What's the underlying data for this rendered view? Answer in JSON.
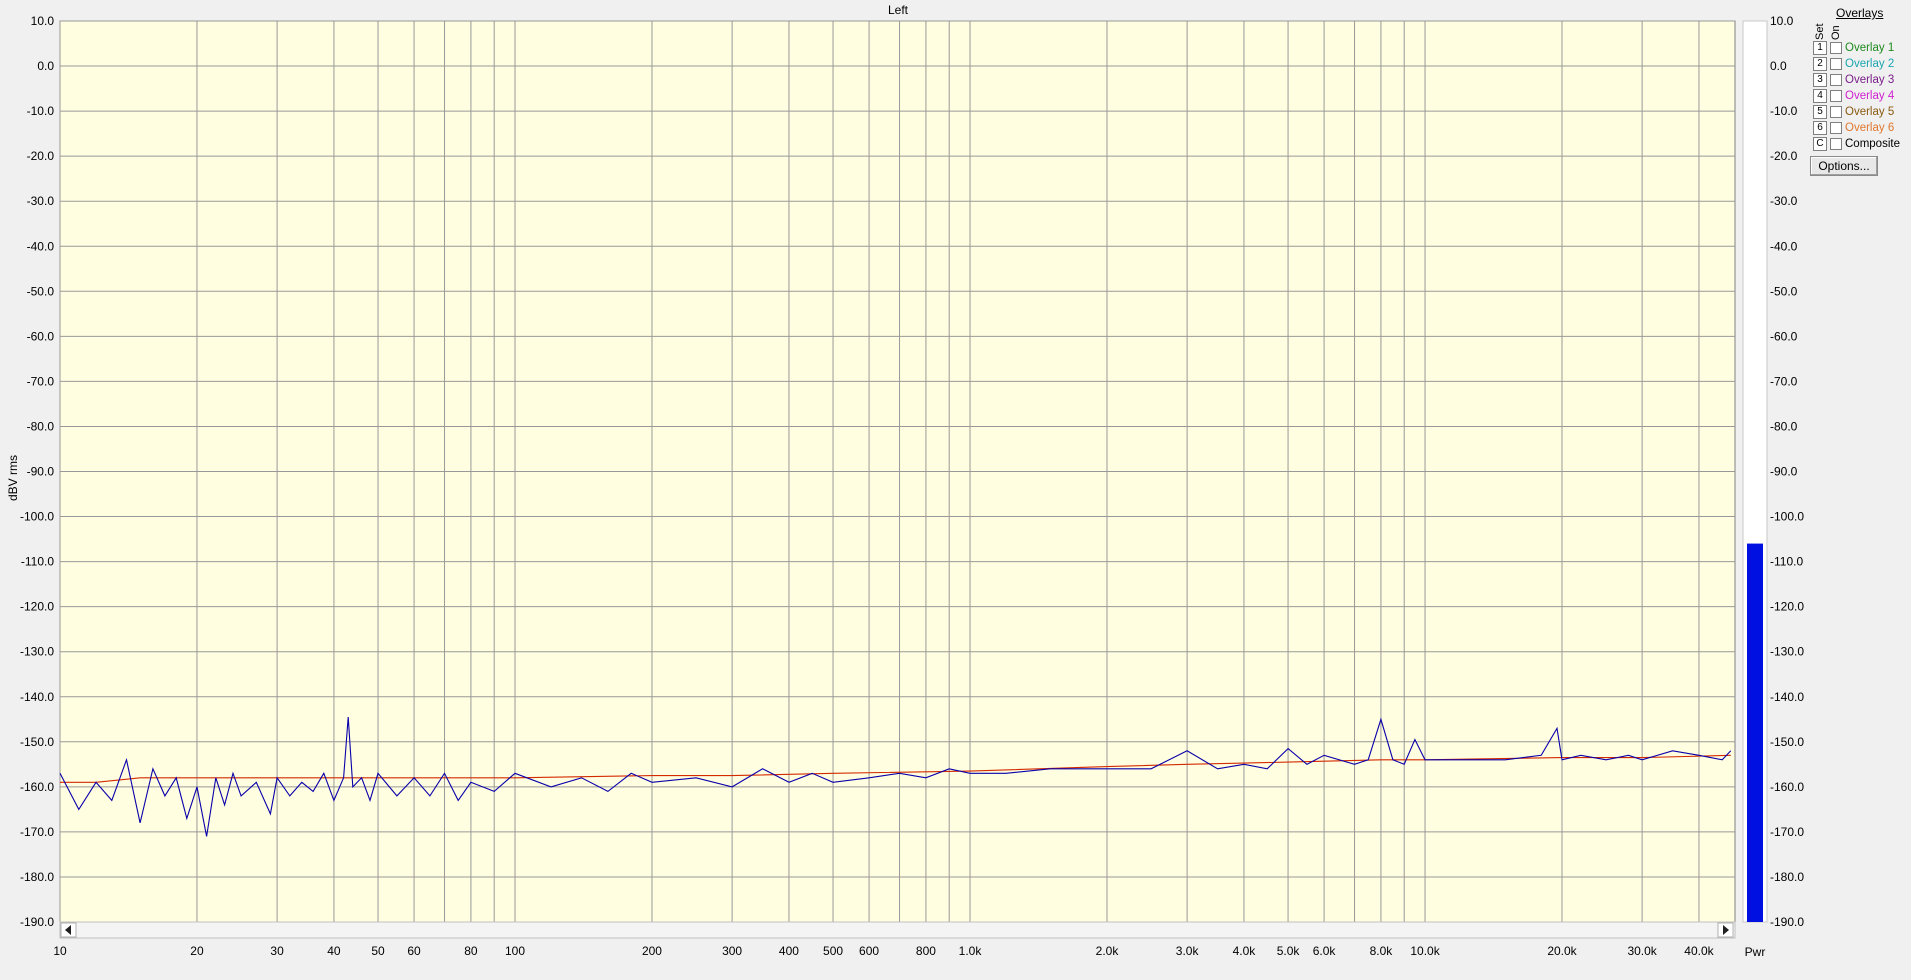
{
  "chart_data": {
    "type": "line",
    "title": "Left",
    "ylabel": "dBV rms",
    "xlabel": "",
    "x_scale": "log",
    "xlim": [
      10,
      48000
    ],
    "ylim": [
      -190,
      10
    ],
    "grid": true,
    "y_ticks": [
      "10.0",
      "0.0",
      "-10.0",
      "-20.0",
      "-30.0",
      "-40.0",
      "-50.0",
      "-60.0",
      "-70.0",
      "-80.0",
      "-90.0",
      "-100.0",
      "-110.0",
      "-120.0",
      "-130.0",
      "-140.0",
      "-150.0",
      "-160.0",
      "-170.0",
      "-180.0",
      "-190.0"
    ],
    "y_tick_values": [
      10,
      0,
      -10,
      -20,
      -30,
      -40,
      -50,
      -60,
      -70,
      -80,
      -90,
      -100,
      -110,
      -120,
      -130,
      -140,
      -150,
      -160,
      -170,
      -180,
      -190
    ],
    "x_ticks": [
      {
        "v": 10,
        "t": "10"
      },
      {
        "v": 20,
        "t": "20"
      },
      {
        "v": 30,
        "t": "30"
      },
      {
        "v": 40,
        "t": "40"
      },
      {
        "v": 50,
        "t": "50"
      },
      {
        "v": 60,
        "t": "60"
      },
      {
        "v": 80,
        "t": "80"
      },
      {
        "v": 100,
        "t": "100"
      },
      {
        "v": 200,
        "t": "200"
      },
      {
        "v": 300,
        "t": "300"
      },
      {
        "v": 400,
        "t": "400"
      },
      {
        "v": 500,
        "t": "500"
      },
      {
        "v": 600,
        "t": "600"
      },
      {
        "v": 800,
        "t": "800"
      },
      {
        "v": 1000,
        "t": "1.0k"
      },
      {
        "v": 2000,
        "t": "2.0k"
      },
      {
        "v": 3000,
        "t": "3.0k"
      },
      {
        "v": 4000,
        "t": "4.0k"
      },
      {
        "v": 5000,
        "t": "5.0k"
      },
      {
        "v": 6000,
        "t": "6.0k"
      },
      {
        "v": 8000,
        "t": "8.0k"
      },
      {
        "v": 10000,
        "t": "10.0k"
      },
      {
        "v": 20000,
        "t": "20.0k"
      },
      {
        "v": 30000,
        "t": "30.0k"
      },
      {
        "v": 40000,
        "t": "40.0k"
      }
    ],
    "x_grid": [
      10,
      20,
      30,
      40,
      50,
      60,
      70,
      80,
      90,
      100,
      200,
      300,
      400,
      500,
      600,
      700,
      800,
      900,
      1000,
      2000,
      3000,
      4000,
      5000,
      6000,
      7000,
      8000,
      9000,
      10000,
      20000,
      30000,
      40000
    ],
    "series": [
      {
        "color": "#d42a00",
        "x": [
          10,
          12,
          15,
          20,
          30,
          43,
          50,
          100,
          200,
          300,
          500,
          1000,
          2000,
          3000,
          5000,
          8000,
          10000,
          20000,
          30000,
          47000
        ],
        "y": [
          -159,
          -159,
          -158,
          -158,
          -158,
          -158,
          -158,
          -158,
          -157.5,
          -157.5,
          -157,
          -156.5,
          -155.5,
          -155,
          -154.5,
          -154,
          -154,
          -153.5,
          -153.5,
          -153
        ]
      },
      {
        "color": "#0a00aa",
        "x": [
          10,
          11,
          12,
          13,
          14,
          15,
          16,
          17,
          18,
          19,
          20,
          21,
          22,
          23,
          24,
          25,
          27,
          29,
          30,
          32,
          34,
          36,
          38,
          40,
          42,
          43,
          44,
          46,
          48,
          50,
          55,
          60,
          65,
          70,
          75,
          80,
          90,
          100,
          120,
          140,
          160,
          180,
          200,
          250,
          300,
          350,
          400,
          450,
          500,
          600,
          700,
          800,
          900,
          1000,
          1200,
          1500,
          2000,
          2500,
          3000,
          3500,
          4000,
          4500,
          5000,
          5500,
          6000,
          7000,
          7500,
          8000,
          8500,
          9000,
          9500,
          10000,
          12000,
          15000,
          18000,
          19500,
          20000,
          22000,
          25000,
          28000,
          30000,
          35000,
          40000,
          45000,
          47000
        ],
        "y": [
          -157,
          -165,
          -159,
          -163,
          -154,
          -168,
          -156,
          -162,
          -158,
          -167,
          -160,
          -171,
          -158,
          -164,
          -157,
          -162,
          -159,
          -166,
          -158,
          -162,
          -159,
          -161,
          -157,
          -163,
          -158,
          -144.5,
          -160,
          -158,
          -163,
          -157,
          -162,
          -158,
          -162,
          -157,
          -163,
          -159,
          -161,
          -157,
          -160,
          -158,
          -161,
          -157,
          -159,
          -158,
          -160,
          -156,
          -159,
          -157,
          -159,
          -158,
          -157,
          -158,
          -156,
          -157,
          -157,
          -156,
          -156,
          -156,
          -152,
          -156,
          -155,
          -156,
          -151.5,
          -155,
          -153,
          -155,
          -154,
          -145,
          -154,
          -155,
          -149.5,
          -154,
          -154,
          -154,
          -153,
          -147,
          -154,
          -153,
          -154,
          -153,
          -154,
          -152,
          -153,
          -154,
          -152
        ]
      }
    ],
    "pwr_meter": {
      "label": "Pwr",
      "value": -106,
      "color": "#0010e0"
    }
  },
  "overlays": {
    "title": "Overlays",
    "col_set": "Set",
    "col_on": "On",
    "items": [
      {
        "key": "1",
        "label": "Overlay 1",
        "color": "#1f8a1f"
      },
      {
        "key": "2",
        "label": "Overlay 2",
        "color": "#1aa6b0"
      },
      {
        "key": "3",
        "label": "Overlay 3",
        "color": "#7a1f8a"
      },
      {
        "key": "4",
        "label": "Overlay 4",
        "color": "#d020d0"
      },
      {
        "key": "5",
        "label": "Overlay 5",
        "color": "#8a5a10"
      },
      {
        "key": "6",
        "label": "Overlay 6",
        "color": "#e07830"
      },
      {
        "key": "C",
        "label": "Composite",
        "color": "#000000"
      }
    ],
    "options_label": "Options..."
  },
  "colors": {
    "plot_bg": "#fffee0",
    "grid": "#999999"
  }
}
